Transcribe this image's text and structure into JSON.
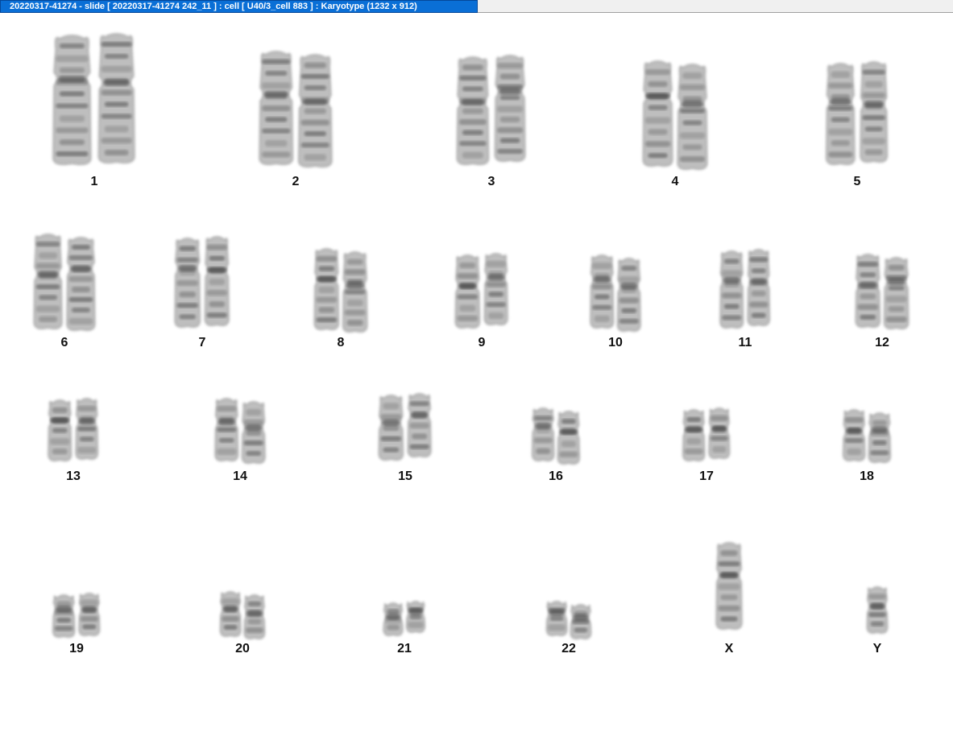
{
  "window": {
    "title": "20220317-41274 - slide [ 20220317-41274 242_11 ] : cell [ U40/3_cell 883 ] : Karyotype  (1232 x 912)",
    "title_bg": "#0a6fd6"
  },
  "karyotype": {
    "chromosomes": [
      {
        "label": "1"
      },
      {
        "label": "2"
      },
      {
        "label": "3"
      },
      {
        "label": "4"
      },
      {
        "label": "5"
      },
      {
        "label": "6"
      },
      {
        "label": "7"
      },
      {
        "label": "8"
      },
      {
        "label": "9"
      },
      {
        "label": "10"
      },
      {
        "label": "11"
      },
      {
        "label": "12"
      },
      {
        "label": "13"
      },
      {
        "label": "14"
      },
      {
        "label": "15"
      },
      {
        "label": "16"
      },
      {
        "label": "17"
      },
      {
        "label": "18"
      },
      {
        "label": "19"
      },
      {
        "label": "20"
      },
      {
        "label": "21"
      },
      {
        "label": "22"
      },
      {
        "label": "X"
      },
      {
        "label": "Y"
      }
    ]
  }
}
